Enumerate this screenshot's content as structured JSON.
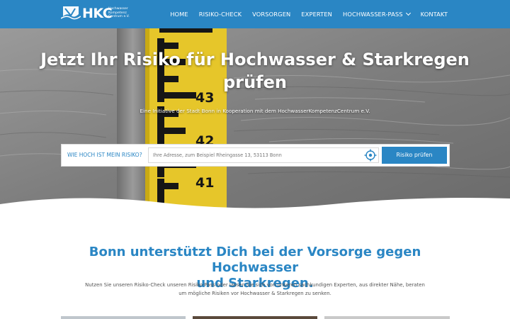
{
  "brand": {
    "name": "HKC",
    "subtitle": [
      "Hochwasser",
      "Kompetenz",
      "Centrum e.V."
    ],
    "color": "#2a86c4"
  },
  "nav": {
    "items": [
      {
        "label": "HOME"
      },
      {
        "label": "RISIKO-CHECK"
      },
      {
        "label": "VORSORGEN"
      },
      {
        "label": "EXPERTEN"
      },
      {
        "label": "HOCHWASSER-PASS"
      },
      {
        "label": "KONTAKT"
      }
    ],
    "dropdown_icon": "chevron-down-icon"
  },
  "hero": {
    "title_line1": "Jetzt Ihr Risiko für Hochwasser & Starkregen",
    "title_line2": "prüfen",
    "subtitle": "Eine Initiative der Stadt Bonn in Kooperation mit dem HochwasserKompetenzCentrum e.V.",
    "gauge_numbers": [
      "43",
      "42",
      "41"
    ]
  },
  "search": {
    "label": "WIE HOCH IST MEIN RISIKO?",
    "placeholder": "Ihre Adresse, zum Beispiel Rheingasse 13, 53113 Bonn",
    "locate_icon": "crosshair-icon",
    "button_label": "Risiko prüfen"
  },
  "content": {
    "headline_line1": "Bonn unterstützt Dich bei der Vorsorge gegen Hochwasser",
    "headline_line2": "und Starkregen.",
    "lead_line1": "Nutzen Sie unseren Risiko-Check unseren Risiko-Pass oder lassen Sie sich von unseren sachkundigen Experten, aus direkter Nähe, beraten",
    "lead_line2": "um mögliche Risiken vor Hochwasser & Starkregen zu senken."
  }
}
